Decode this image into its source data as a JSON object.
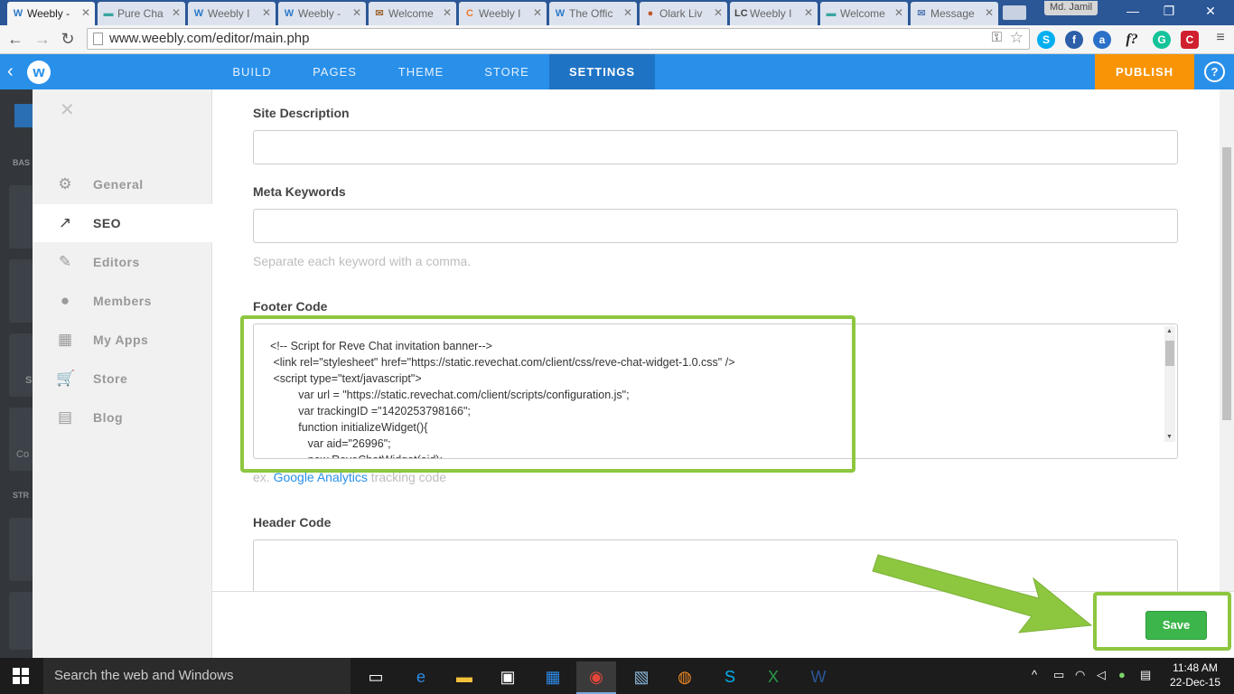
{
  "browser": {
    "tabs": [
      {
        "title": "Weebly -",
        "icon": "W",
        "icon_color": "#2b79c9",
        "active": true
      },
      {
        "title": "Pure Cha",
        "icon": "▬",
        "icon_color": "#3aa6a0"
      },
      {
        "title": "Weebly I",
        "icon": "W",
        "icon_color": "#2b79c9"
      },
      {
        "title": "Weebly -",
        "icon": "W",
        "icon_color": "#2b79c9"
      },
      {
        "title": "Welcome",
        "icon": "✉",
        "icon_color": "#a06a3a"
      },
      {
        "title": "Weebly I",
        "icon": "C",
        "icon_color": "#f3772a"
      },
      {
        "title": "The Offic",
        "icon": "W",
        "icon_color": "#2b79c9"
      },
      {
        "title": "Olark Liv",
        "icon": "●",
        "icon_color": "#c2552a"
      },
      {
        "title": "Weebly I",
        "icon": "LC",
        "icon_color": "#444444"
      },
      {
        "title": "Welcome",
        "icon": "▬",
        "icon_color": "#3aa6a0"
      },
      {
        "title": "Message",
        "icon": "✉",
        "icon_color": "#5a7ab5"
      }
    ],
    "profile_name": "Md. Jamil",
    "url": "www.weebly.com/editor/main.php"
  },
  "weebly": {
    "nav": [
      "BUILD",
      "PAGES",
      "THEME",
      "STORE",
      "SETTINGS"
    ],
    "active_nav": "SETTINGS",
    "publish_label": "PUBLISH",
    "help_label": "?",
    "logo_letter": "w"
  },
  "editor_strip": {
    "label1": "BAS",
    "label2": "STR",
    "label3": "Co",
    "label4": "S"
  },
  "sidebar": {
    "items": [
      {
        "label": "General",
        "icon": "⚙",
        "active": false
      },
      {
        "label": "SEO",
        "icon": "↗",
        "active": true
      },
      {
        "label": "Editors",
        "icon": "✎",
        "active": false
      },
      {
        "label": "Members",
        "icon": "●",
        "active": false
      },
      {
        "label": "My Apps",
        "icon": "▦",
        "active": false
      },
      {
        "label": "Store",
        "icon": "🛒",
        "active": false
      },
      {
        "label": "Blog",
        "icon": "▤",
        "active": false
      }
    ]
  },
  "form": {
    "site_description_label": "Site Description",
    "site_description_value": "",
    "meta_keywords_label": "Meta Keywords",
    "meta_keywords_value": "",
    "meta_keywords_hint": "Separate each keyword with a comma.",
    "footer_code_label": "Footer Code",
    "footer_code_value": "<!-- Script for Reve Chat invitation banner-->\n <link rel=\"stylesheet\" href=\"https://static.revechat.com/client/css/reve-chat-widget-1.0.css\" />\n <script type=\"text/javascript\">\n         var url = \"https://static.revechat.com/client/scripts/configuration.js\";\n         var trackingID =\"1420253798166\";\n         function initializeWidget(){\n            var aid=\"26996\";\n            new ReveChatWidget(aid);",
    "footer_hint_prefix": "ex.",
    "footer_hint_link": "Google Analytics",
    "footer_hint_suffix": "tracking code",
    "header_code_label": "Header Code",
    "header_code_value": ""
  },
  "save_label": "Save",
  "taskbar": {
    "search_placeholder": "Search the web and Windows",
    "time": "11:48 AM",
    "date": "22-Dec-15"
  },
  "colors": {
    "weebly_blue": "#2990ea",
    "settings_active": "#1f73c4",
    "publish_orange": "#f89406",
    "save_green": "#3cb54a",
    "annotation_green": "#8dc63f"
  }
}
